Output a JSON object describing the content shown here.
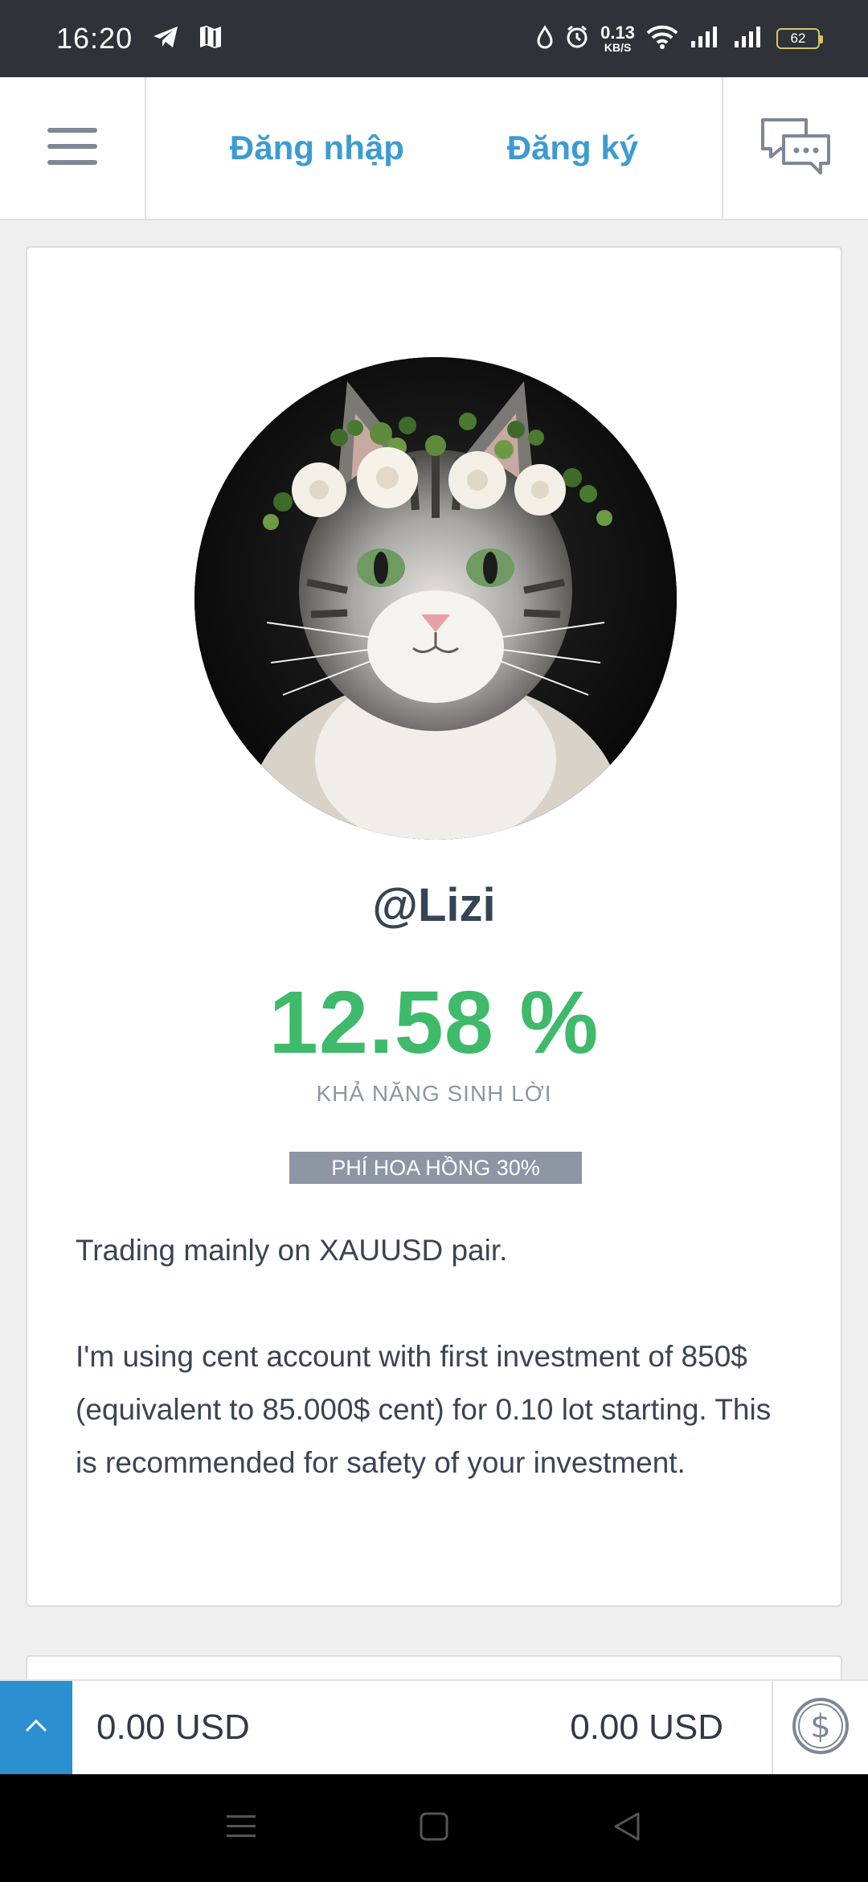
{
  "status": {
    "time": "16:20",
    "net_speed_value": "0.13",
    "net_speed_unit": "KB/S",
    "battery": "62"
  },
  "header": {
    "login_label": "Đăng nhập",
    "register_label": "Đăng ký"
  },
  "profile": {
    "username": "@Lizi",
    "profit_value": "12.58 %",
    "profit_label": "KHẢ NĂNG SINH LỜI",
    "fee_badge": "PHÍ HOA HỒNG 30%",
    "description": [
      "Trading mainly on XAUUSD pair.",
      "I'm using cent account with first investment of 850$ (equivalent to 85.000$ cent) for 0.10 lot starting. This is recommended for safety of your investment."
    ]
  },
  "bottom_bar": {
    "balance_left": "0.00 USD",
    "balance_right": "0.00 USD"
  },
  "colors": {
    "accent": "#3d9bd3",
    "profit_green": "#3fba6a",
    "badge_gray": "#8e96a4",
    "scroll_up_blue": "#2c8fd0"
  }
}
